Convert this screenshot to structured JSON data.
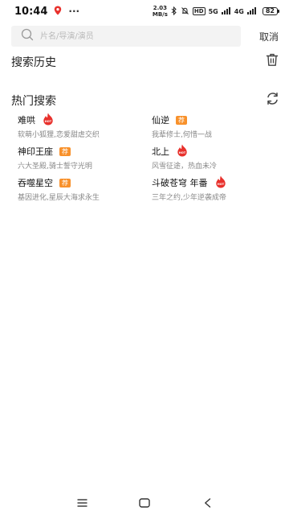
{
  "status_bar": {
    "time": "10:44",
    "more": "···",
    "net_speed_value": "2.03",
    "net_speed_unit": "MB/s",
    "hd": "HD",
    "signal_1": "5G",
    "signal_2": "4G",
    "battery": "82"
  },
  "search": {
    "placeholder": "片名/导演/演员",
    "value": "",
    "cancel_label": "取消"
  },
  "history": {
    "title": "搜索历史"
  },
  "hot": {
    "title": "热门搜索",
    "items": [
      {
        "title": "难哄",
        "desc": "软萌小狐狸,恋爱甜虐交织",
        "badge": "hot"
      },
      {
        "title": "仙逆",
        "desc": "我辈修士,何惜一战",
        "badge": "rec",
        "badge_text": "荐"
      },
      {
        "title": "神印王座",
        "desc": "六大圣殿,骑士誓守光明",
        "badge": "rec",
        "badge_text": "荐"
      },
      {
        "title": "北上",
        "desc": "风雪征途，热血未冷",
        "badge": "hot"
      },
      {
        "title": "吞噬星空",
        "desc": "基因进化,星辰大海求永生",
        "badge": "rec",
        "badge_text": "荐"
      },
      {
        "title": "斗破苍穹 年番",
        "desc": "三年之约,少年逆袭成帝",
        "badge": "hot"
      }
    ]
  },
  "colors": {
    "hot_red": "#e8312c",
    "rec_orange": "#f8912b",
    "search_bg": "#f3f3f3",
    "desc_gray": "#888888"
  },
  "icons": {
    "search": "search-icon",
    "trash": "trash-icon",
    "refresh": "refresh-icon",
    "hot": "hot-flame-icon",
    "nav_menu": "menu-icon",
    "nav_home": "home-icon",
    "nav_back": "back-icon"
  }
}
